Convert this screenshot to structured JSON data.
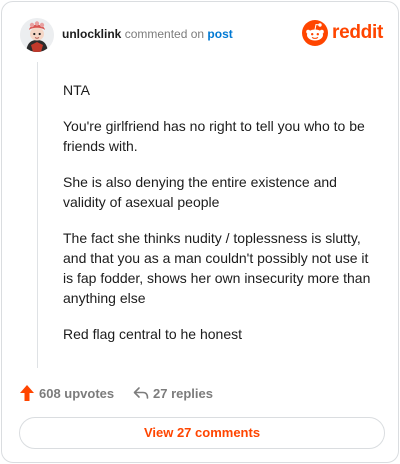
{
  "header": {
    "username": "unlocklink",
    "commented_on": "commented on",
    "post_link": "post",
    "brand_name": "reddit"
  },
  "comment": {
    "paragraphs": [
      "NTA",
      "You're girlfriend has no right to tell you who to be friends with.",
      "She is also denying the entire existence and validity of asexual people",
      "The fact she thinks nudity / toplessness is slutty, and that you as a man couldn't possibly not use it is fap fodder, shows her own insecurity more than anything else",
      "Red flag central to he honest"
    ]
  },
  "actions": {
    "upvotes": "608 upvotes",
    "replies": "27 replies"
  },
  "view_button": "View 27 comments",
  "colors": {
    "brand": "#ff4500",
    "link": "#0079d3",
    "muted": "#7c7c7c",
    "border": "#dadde0"
  },
  "icons": [
    "avatar",
    "reddit-logo-icon",
    "upvote-arrow-icon",
    "reply-arrow-icon"
  ]
}
